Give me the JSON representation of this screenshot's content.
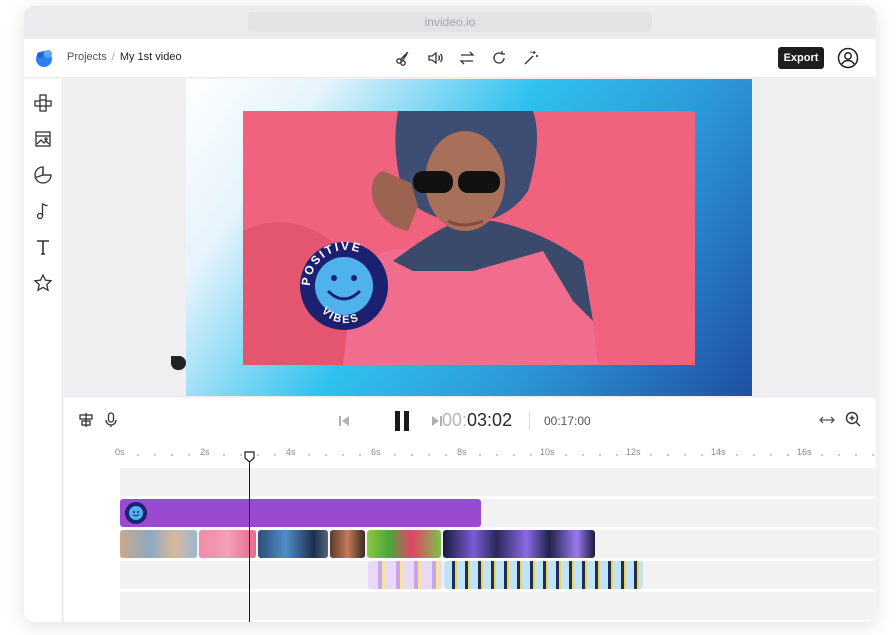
{
  "browser": {
    "url": "invideo.io"
  },
  "header": {
    "breadcrumb_root": "Projects",
    "breadcrumb_sep": "/",
    "breadcrumb_current": "My 1st video",
    "export_label": "Export",
    "tools": [
      "scissors-icon",
      "volume-icon",
      "swap-icon",
      "rotate-icon",
      "magic-wand-icon"
    ]
  },
  "sidebar": {
    "items": [
      "layout-icon",
      "media-icon",
      "sticker-icon",
      "music-icon",
      "text-icon",
      "star-icon"
    ]
  },
  "canvas": {
    "sticker_text_top": "POSITIVE",
    "sticker_text_bottom": "VIBES"
  },
  "playback": {
    "current_prefix": "00:",
    "current_time": "03:02",
    "total_time": "00:17:00"
  },
  "ruler": {
    "labels": [
      "0s",
      "2s",
      "4s",
      "6s",
      "8s",
      "10s",
      "12s",
      "14s",
      "16s"
    ]
  },
  "colors": {
    "accent_purple": "#9a4ad1",
    "export_bg": "#1e1e1e",
    "photo_bg": "#f1627e",
    "logo_blue": "#2f7df0"
  }
}
